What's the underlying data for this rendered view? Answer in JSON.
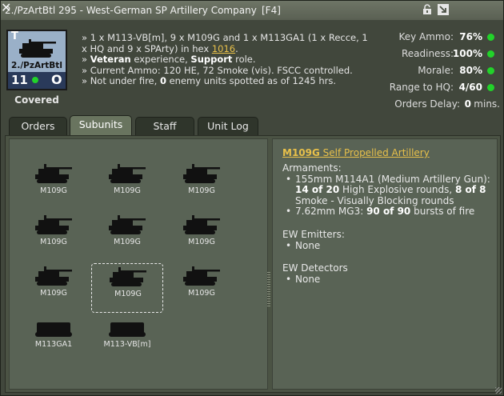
{
  "window": {
    "title": "2./PzArtBtl 295 - West-German SP Artillery Company",
    "hotkey": "[F4]"
  },
  "counter": {
    "top_left": "T",
    "name": "2./PzArtBtl",
    "strength": "11",
    "bottom_right": "O",
    "status": "Covered"
  },
  "info": {
    "line1a": "» 1 x M113-VB[m], 9 x M109G and 1 x M113GA1 (1 x Recce, 1 x HQ and 9 x SPArty) in hex ",
    "hex": "1016",
    "line1b": ".",
    "l2_pre": "» ",
    "experience": "Veteran",
    "l2_mid": " experience, ",
    "role": "Support",
    "l2_post": " role.",
    "line3": "» Current Ammo: 120 HE, 72 Smoke (vis). FSCC controlled.",
    "l4_pre": "» Not under fire, ",
    "enemy_count": "0",
    "l4_post": " enemy units spotted as of 1245 hrs."
  },
  "stats": [
    {
      "label": "Key Ammo:",
      "value": "76%",
      "dot": true
    },
    {
      "label": "Readiness:",
      "value": "100%",
      "dot": true
    },
    {
      "label": "Morale:",
      "value": "80%",
      "dot": true
    },
    {
      "label": "Range to HQ:",
      "value": "4/60",
      "dot": true
    },
    {
      "label": "Orders Delay:",
      "value": "0",
      "unit": "mins.",
      "dot": false
    }
  ],
  "tabs": [
    "Orders",
    "Subunits",
    "Staff",
    "Unit Log"
  ],
  "subunits": [
    {
      "label": "M109G",
      "kind": "sp"
    },
    {
      "label": "M109G",
      "kind": "sp"
    },
    {
      "label": "M109G",
      "kind": "sp"
    },
    {
      "label": "M109G",
      "kind": "sp"
    },
    {
      "label": "M109G",
      "kind": "sp"
    },
    {
      "label": "M109G",
      "kind": "sp"
    },
    {
      "label": "M109G",
      "kind": "sp"
    },
    {
      "label": "M109G",
      "kind": "sp",
      "selected": true
    },
    {
      "label": "M109G",
      "kind": "sp"
    },
    {
      "label": "M113GA1",
      "kind": "apc"
    },
    {
      "label": "M113-VB[m]",
      "kind": "apc"
    }
  ],
  "detail": {
    "name": "M109G",
    "type": " Self Propelled Artillery",
    "armaments_label": "Armaments:",
    "arm1_pre": "155mm M114A1 (Medium Artillery Gun):",
    "arm1_he": "14 of 20",
    "arm1_he_text": " High Explosive rounds, ",
    "arm1_sm": "8 of 8",
    "arm1_sm_text": " Smoke - Visually Blocking rounds",
    "arm2_pre": "7.62mm MG3: ",
    "arm2_val": "90 of 90",
    "arm2_post": " bursts of fire",
    "emitters_label": "EW Emitters:",
    "emitters_value": "None",
    "detectors_label": "EW Detectors",
    "detectors_value": "None"
  },
  "colors": {
    "accent_yellow": "#e8c04a",
    "status_green": "#22d22a",
    "counter_blue": "#9ab0c8"
  }
}
